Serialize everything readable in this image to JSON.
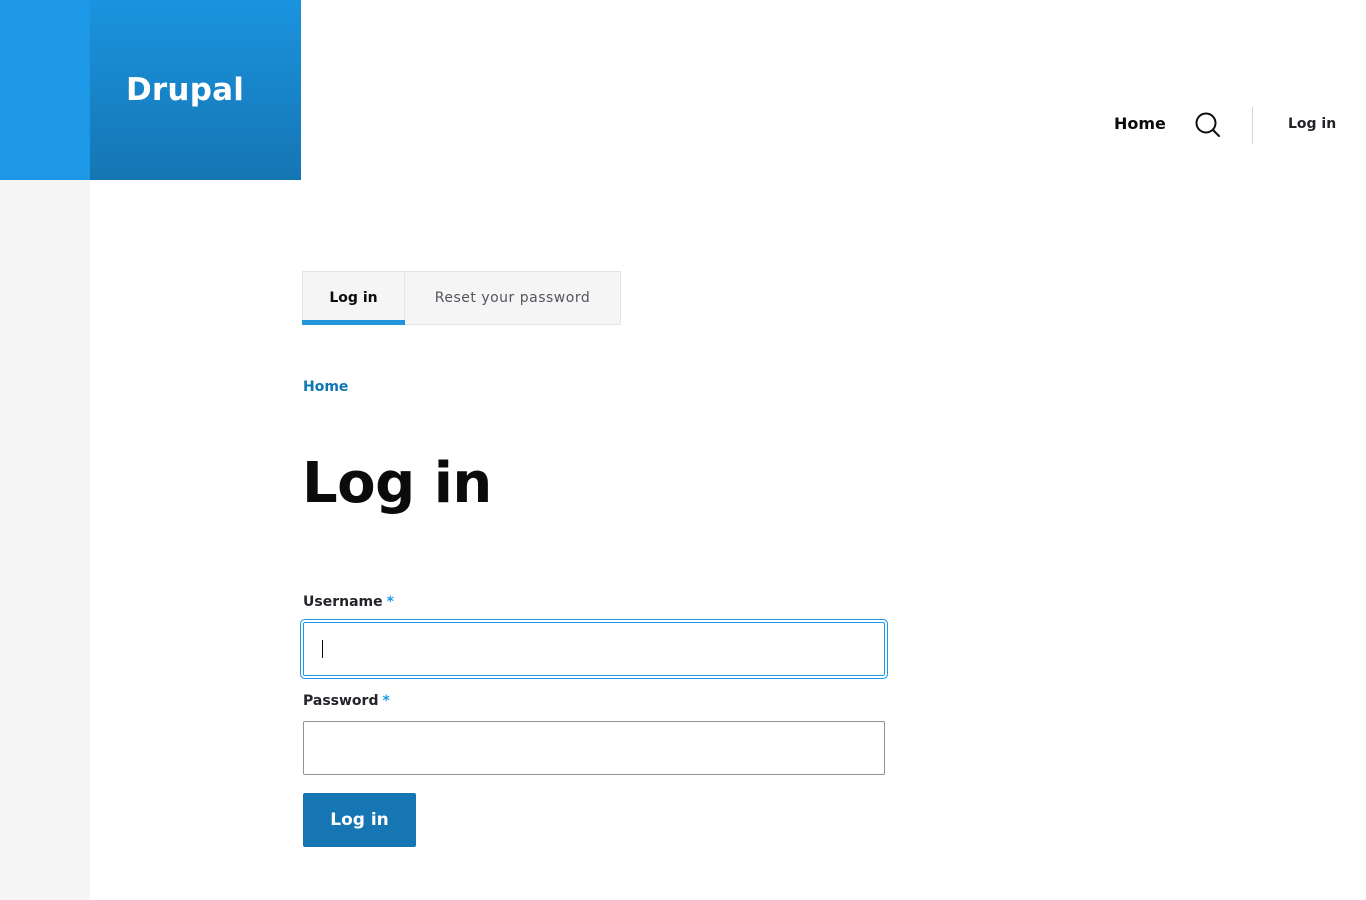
{
  "site": {
    "name": "Drupal",
    "colors": {
      "brand_blue": "#1c98e6",
      "brand_dark": "#1576b3",
      "link_blue": "#0d77b5",
      "gutter_gray": "#f4f5f4"
    }
  },
  "header_nav": {
    "home_label": "Home",
    "search_icon": "search-icon",
    "login_label": "Log in"
  },
  "tabs": [
    {
      "label": "Log in",
      "active": true
    },
    {
      "label": "Reset your password",
      "active": false
    }
  ],
  "breadcrumb": {
    "home_label": "Home"
  },
  "page": {
    "title": "Log in"
  },
  "form": {
    "username": {
      "label": "Username",
      "required_marker": "*",
      "value": "",
      "focused": true
    },
    "password": {
      "label": "Password",
      "required_marker": "*",
      "value": ""
    },
    "submit_label": "Log in"
  }
}
